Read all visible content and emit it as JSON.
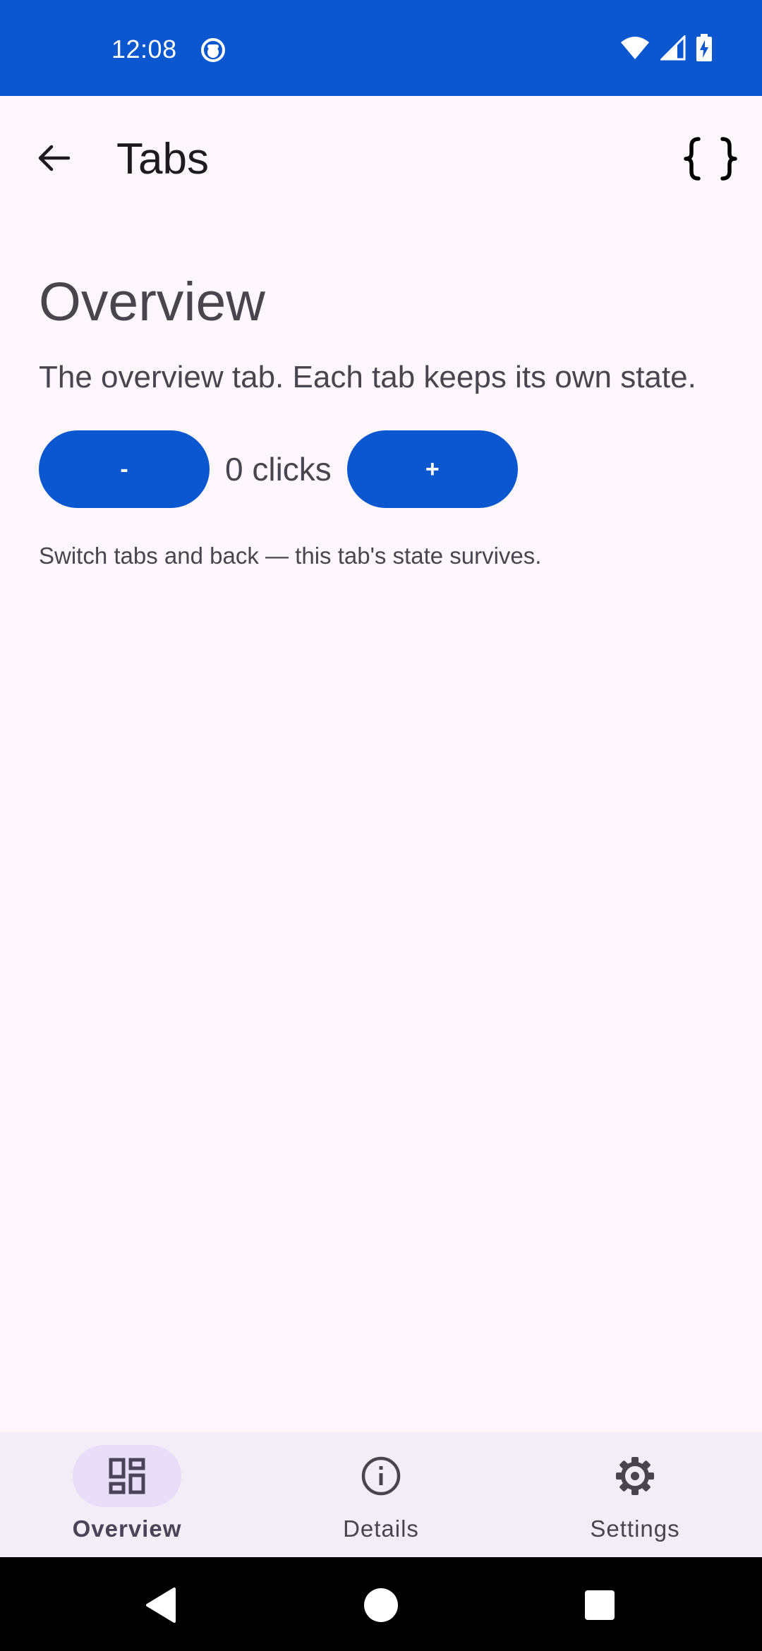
{
  "status_bar": {
    "time": "12:08",
    "background_color": "#0b57d0",
    "icons": [
      "app-notification-icon",
      "wifi-icon",
      "signal-icon",
      "battery-charging-icon"
    ]
  },
  "app_bar": {
    "title": "Tabs",
    "back_icon": "arrow-back-icon",
    "action_icon": "code-braces-icon"
  },
  "main": {
    "title": "Overview",
    "description": "The overview tab. Each tab keeps its own state.",
    "counter": {
      "decrement_label": "-",
      "increment_label": "+",
      "value_text": "0 clicks",
      "button_color": "#0b57d0"
    },
    "hint": "Switch tabs and back — this tab's state survives."
  },
  "bottom_nav": {
    "items": [
      {
        "label": "Overview",
        "icon": "dashboard-icon",
        "selected": true
      },
      {
        "label": "Details",
        "icon": "info-icon",
        "selected": false
      },
      {
        "label": "Settings",
        "icon": "gear-icon",
        "selected": false
      }
    ],
    "indicator_color": "#e8def8"
  },
  "system_nav": {
    "icons": [
      "back-triangle-icon",
      "home-circle-icon",
      "recents-square-icon"
    ]
  }
}
